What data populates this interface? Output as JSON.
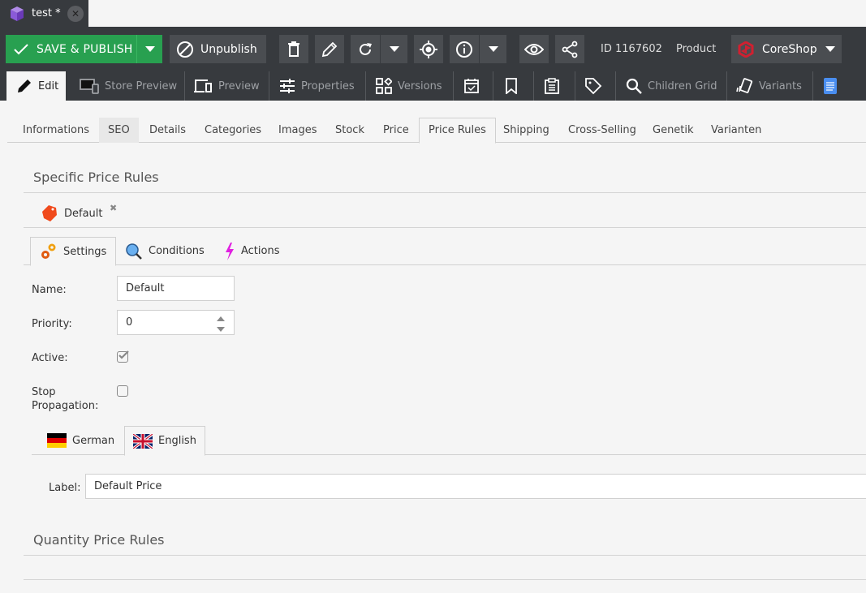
{
  "document_tab": {
    "title": "test *",
    "icon": "object-cube-icon",
    "close_icon": "close-icon"
  },
  "toolbar": {
    "save_publish_label": "SAVE & PUBLISH",
    "unpublish_label": "Unpublish",
    "icons": [
      "delete-icon",
      "rename-icon",
      "reload-icon",
      "locate-icon",
      "info-icon",
      "preview-eye-icon",
      "share-icon"
    ],
    "object_id": "ID 1167602",
    "object_type": "Product",
    "coreshop_label": "CoreShop",
    "save_color": "#28a050"
  },
  "subnav": {
    "items": [
      {
        "label": "Edit",
        "icon": "pencil-icon",
        "active": true
      },
      {
        "label": "Store Preview",
        "icon": "store-preview-icon"
      },
      {
        "label": "Preview",
        "icon": "devices-icon"
      },
      {
        "label": "Properties",
        "icon": "sliders-icon"
      },
      {
        "label": "Versions",
        "icon": "versions-icon"
      },
      {
        "label": "",
        "icon": "schedule-calendar-icon"
      },
      {
        "label": "",
        "icon": "bookmark-icon"
      },
      {
        "label": "",
        "icon": "notes-clipboard-icon"
      },
      {
        "label": "",
        "icon": "tag-icon"
      },
      {
        "label": "Children Grid",
        "icon": "search-icon"
      },
      {
        "label": "Variants",
        "icon": "variants-icon"
      },
      {
        "label": "",
        "icon": "document-icon"
      }
    ]
  },
  "object_tabs": [
    {
      "label": "Informations"
    },
    {
      "label": "SEO",
      "hover": true
    },
    {
      "label": "Details"
    },
    {
      "label": "Categories"
    },
    {
      "label": "Images"
    },
    {
      "label": "Stock"
    },
    {
      "label": "Price"
    },
    {
      "label": "Price Rules",
      "active": true
    },
    {
      "label": "Shipping"
    },
    {
      "label": "Cross-Selling"
    },
    {
      "label": "Genetik"
    },
    {
      "label": "Varianten"
    }
  ],
  "specific_price_rules": {
    "title": "Specific Price Rules",
    "rule_tab_label": "Default",
    "inner_tabs": [
      {
        "label": "Settings",
        "icon": "settings-gears-icon",
        "active": true
      },
      {
        "label": "Conditions",
        "icon": "magnifier-icon"
      },
      {
        "label": "Actions",
        "icon": "lightning-icon"
      }
    ],
    "form": {
      "name_label": "Name:",
      "name_value": "Default",
      "priority_label": "Priority:",
      "priority_value": "0",
      "active_label": "Active:",
      "active_checked": true,
      "stop_propagation_label_1": "Stop",
      "stop_propagation_label_2": "Propagation:",
      "stop_propagation_checked": false
    },
    "languages": [
      {
        "label": "German",
        "icon": "flag-de-icon"
      },
      {
        "label": "English",
        "icon": "flag-gb-icon",
        "active": true
      }
    ],
    "label_field": {
      "label": "Label:",
      "value": "Default Price"
    }
  },
  "quantity_price_rules": {
    "title": "Quantity Price Rules"
  }
}
